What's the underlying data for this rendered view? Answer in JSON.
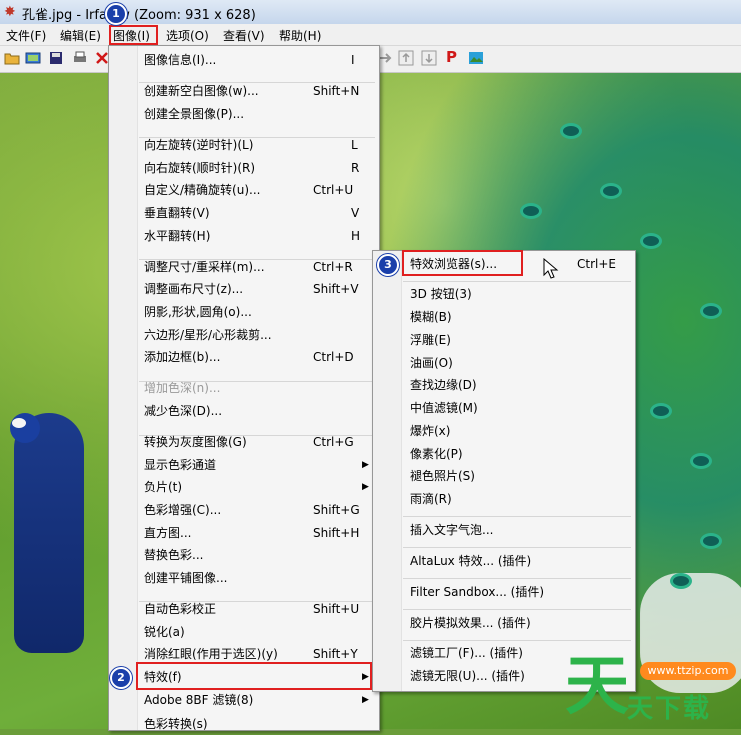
{
  "window": {
    "title": "孔雀.jpg - Irfan   w (Zoom: 931 x 628)"
  },
  "menubar": [
    {
      "label": "文件(F)"
    },
    {
      "label": "编辑(E)"
    },
    {
      "label": "图像(I)"
    },
    {
      "label": "选项(O)"
    },
    {
      "label": "查看(V)"
    },
    {
      "label": "帮助(H)"
    }
  ],
  "toolbar": {
    "icons": [
      "open-folder-icon",
      "slideshow-icon",
      "save-icon",
      "print-icon",
      "delete-icon",
      "arrow-right-icon",
      "up-icon",
      "down-icon",
      "paint-icon",
      "image-edit-icon"
    ],
    "paint_label": "P"
  },
  "image_menu": {
    "items": [
      {
        "label": "图像信息(I)...",
        "shortcut": "I"
      },
      {
        "label": "创建新空白图像(w)...",
        "shortcut": "Shift+N"
      },
      {
        "label": "创建全景图像(P)...",
        "shortcut": ""
      },
      {
        "label": "向左旋转(逆时针)(L)",
        "shortcut": "L"
      },
      {
        "label": "向右旋转(顺时针)(R)",
        "shortcut": "R"
      },
      {
        "label": "自定义/精确旋转(u)...",
        "shortcut": "Ctrl+U"
      },
      {
        "label": "垂直翻转(V)",
        "shortcut": "V"
      },
      {
        "label": "水平翻转(H)",
        "shortcut": "H"
      },
      {
        "label": "调整尺寸/重采样(m)...",
        "shortcut": "Ctrl+R"
      },
      {
        "label": "调整画布尺寸(z)...",
        "shortcut": "Shift+V"
      },
      {
        "label": "阴影,形状,圆角(o)...",
        "shortcut": ""
      },
      {
        "label": "六边形/星形/心形裁剪...",
        "shortcut": ""
      },
      {
        "label": "添加边框(b)...",
        "shortcut": "Ctrl+D"
      },
      {
        "label": "增加色深(n)...",
        "shortcut": ""
      },
      {
        "label": "减少色深(D)...",
        "shortcut": ""
      },
      {
        "label": "转换为灰度图像(G)",
        "shortcut": "Ctrl+G"
      },
      {
        "label": "显示色彩通道",
        "shortcut": ""
      },
      {
        "label": "负片(t)",
        "shortcut": ""
      },
      {
        "label": "色彩增强(C)...",
        "shortcut": "Shift+G"
      },
      {
        "label": "直方图...",
        "shortcut": "Shift+H"
      },
      {
        "label": "替换色彩...",
        "shortcut": ""
      },
      {
        "label": "创建平铺图像...",
        "shortcut": ""
      },
      {
        "label": "自动色彩校正",
        "shortcut": "Shift+U"
      },
      {
        "label": "锐化(a)",
        "shortcut": ""
      },
      {
        "label": "消除红眼(作用于选区)(y)",
        "shortcut": "Shift+Y"
      },
      {
        "label": "特效(f)",
        "shortcut": ""
      },
      {
        "label": "Adobe 8BF 滤镜(8)",
        "shortcut": ""
      },
      {
        "label": "色彩转换(s)",
        "shortcut": ""
      }
    ]
  },
  "effects_menu": {
    "items": [
      {
        "label": "特效浏览器(s)...",
        "shortcut": "Ctrl+E"
      },
      {
        "label": "3D 按钮(3)",
        "shortcut": ""
      },
      {
        "label": "模糊(B)",
        "shortcut": ""
      },
      {
        "label": "浮雕(E)",
        "shortcut": ""
      },
      {
        "label": "油画(O)",
        "shortcut": ""
      },
      {
        "label": "查找边缘(D)",
        "shortcut": ""
      },
      {
        "label": "中值滤镜(M)",
        "shortcut": ""
      },
      {
        "label": "爆炸(x)",
        "shortcut": ""
      },
      {
        "label": "像素化(P)",
        "shortcut": ""
      },
      {
        "label": "褪色照片(S)",
        "shortcut": ""
      },
      {
        "label": "雨滴(R)",
        "shortcut": ""
      },
      {
        "label": "插入文字气泡...",
        "shortcut": ""
      },
      {
        "label": "AltaLux 特效... (插件)",
        "shortcut": ""
      },
      {
        "label": "Filter Sandbox... (插件)",
        "shortcut": ""
      },
      {
        "label": "胶片模拟效果... (插件)",
        "shortcut": ""
      },
      {
        "label": "滤镜工厂(F)... (插件)",
        "shortcut": ""
      },
      {
        "label": "滤镜无限(U)... (插件)",
        "shortcut": ""
      }
    ]
  },
  "callouts": {
    "step1": "1",
    "step2": "2",
    "step3": "3"
  },
  "watermark": {
    "url": "www.ttzip.com",
    "glyph": "天",
    "brand": "天下载"
  },
  "colors": {
    "highlight": "#e02020",
    "badge": "#1a3faa",
    "menu_bg": "#f5f5f5"
  }
}
